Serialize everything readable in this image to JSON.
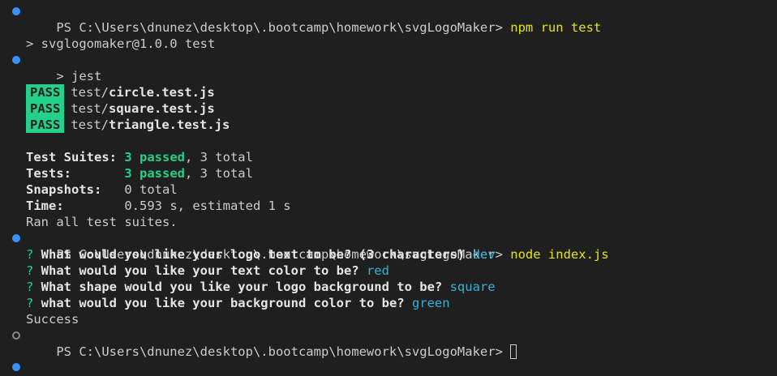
{
  "prompt1": {
    "ps": "PS C:\\Users\\dnunez\\desktop\\.bootcamp\\homework\\svgLogoMaker> ",
    "cmd": "npm run test"
  },
  "npm_output": {
    "line1": "> svglogomaker@1.0.0 test",
    "line2": "> jest"
  },
  "tests": [
    {
      "badge": "PASS",
      "dir": "test/",
      "file": "circle.test.js"
    },
    {
      "badge": "PASS",
      "dir": "test/",
      "file": "square.test.js"
    },
    {
      "badge": "PASS",
      "dir": "test/",
      "file": "triangle.test.js"
    }
  ],
  "summary": {
    "suites_label": "Test Suites: ",
    "suites_passed": "3 passed",
    "suites_total": ", 3 total",
    "tests_label": "Tests:       ",
    "tests_passed": "3 passed",
    "tests_total": ", 3 total",
    "snapshots_label": "Snapshots:   ",
    "snapshots_value": "0 total",
    "time_label": "Time:        ",
    "time_value": "0.593 s, estimated 1 s",
    "ran": "Ran all test suites."
  },
  "prompt2": {
    "ps": "PS C:\\Users\\dnunez\\desktop\\.bootcamp\\homework\\svgLogoMaker> ",
    "cmd": "node index.js"
  },
  "questions": [
    {
      "mark": "?",
      "q": " What would you like your logo text to be? (3 characters) ",
      "a": "dev"
    },
    {
      "mark": "?",
      "q": " What would you like your text color to be? ",
      "a": "red"
    },
    {
      "mark": "?",
      "q": " What shape would you like your logo background to be? ",
      "a": "square"
    },
    {
      "mark": "?",
      "q": " what would you like your background color to be? ",
      "a": "green"
    }
  ],
  "success": "Success",
  "prompt3": {
    "ps": "PS C:\\Users\\dnunez\\desktop\\.bootcamp\\homework\\svgLogoMaker> "
  },
  "colors": {
    "background": "#1f1f1f",
    "foreground": "#cccccc",
    "command": "#e5e510",
    "pass": "#23d18b",
    "answer": "#29b8db",
    "decoration": "#3794ff"
  }
}
